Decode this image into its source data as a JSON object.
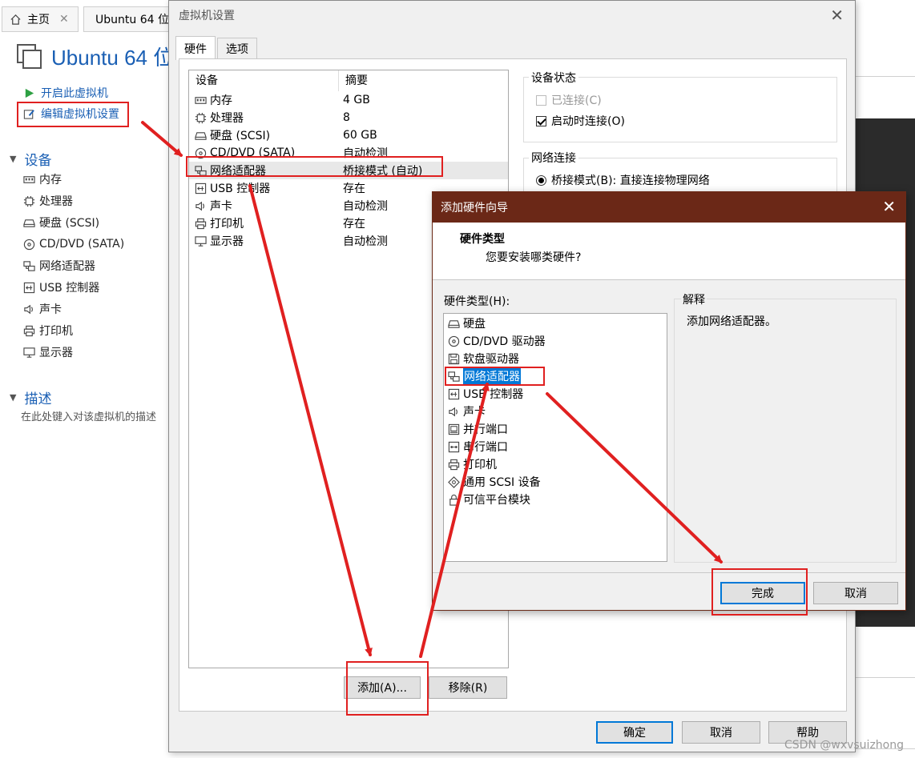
{
  "main_window": {
    "tabs": [
      {
        "label": "主页",
        "icon": "home-icon"
      },
      {
        "label": "Ubuntu 64 位",
        "icon": "vm-icon"
      }
    ],
    "vm_title": "Ubuntu 64 位",
    "actions": [
      {
        "label": "开启此虚拟机",
        "icon": "play-icon"
      },
      {
        "label": "编辑虚拟机设置",
        "icon": "edit-settings-icon"
      }
    ],
    "devices_section": "设备",
    "devices": [
      {
        "label": "内存",
        "icon": "memory-icon"
      },
      {
        "label": "处理器",
        "icon": "cpu-icon"
      },
      {
        "label": "硬盘 (SCSI)",
        "icon": "harddisk-icon"
      },
      {
        "label": "CD/DVD (SATA)",
        "icon": "cdrom-icon"
      },
      {
        "label": "网络适配器",
        "icon": "network-adapter-icon"
      },
      {
        "label": "USB 控制器",
        "icon": "usb-icon"
      },
      {
        "label": "声卡",
        "icon": "sound-icon"
      },
      {
        "label": "打印机",
        "icon": "printer-icon"
      },
      {
        "label": "显示器",
        "icon": "display-icon"
      }
    ],
    "description_section": "描述",
    "description_hint": "在此处键入对该虚拟机的描述"
  },
  "settings_dialog": {
    "title": "虚拟机设置",
    "tabs": [
      "硬件",
      "选项"
    ],
    "device_table": {
      "headers": [
        "设备",
        "摘要"
      ],
      "rows": [
        {
          "device": "内存",
          "summary": "4 GB",
          "icon": "memory-icon"
        },
        {
          "device": "处理器",
          "summary": "8",
          "icon": "cpu-icon"
        },
        {
          "device": "硬盘 (SCSI)",
          "summary": "60 GB",
          "icon": "harddisk-icon"
        },
        {
          "device": "CD/DVD (SATA)",
          "summary": "自动检测",
          "icon": "cdrom-icon"
        },
        {
          "device": "网络适配器",
          "summary": "桥接模式 (自动)",
          "icon": "network-adapter-icon"
        },
        {
          "device": "USB 控制器",
          "summary": "存在",
          "icon": "usb-icon"
        },
        {
          "device": "声卡",
          "summary": "自动检测",
          "icon": "sound-icon"
        },
        {
          "device": "打印机",
          "summary": "存在",
          "icon": "printer-icon"
        },
        {
          "device": "显示器",
          "summary": "自动检测",
          "icon": "display-icon"
        }
      ]
    },
    "device_status": {
      "label": "设备状态",
      "connected": "已连接(C)",
      "connect_on_start": "启动时连接(O)"
    },
    "network": {
      "label": "网络连接",
      "bridged": "桥接模式(B): 直接连接物理网络"
    },
    "buttons": {
      "add": "添加(A)...",
      "remove": "移除(R)",
      "ok": "确定",
      "cancel": "取消",
      "help": "帮助"
    }
  },
  "wizard": {
    "title": "添加硬件向导",
    "heading": "硬件类型",
    "subheading": "您要安装哪类硬件?",
    "list_label": "硬件类型(H):",
    "items": [
      {
        "label": "硬盘",
        "icon": "harddisk-icon"
      },
      {
        "label": "CD/DVD 驱动器",
        "icon": "cdrom-icon"
      },
      {
        "label": "软盘驱动器",
        "icon": "floppy-icon"
      },
      {
        "label": "网络适配器",
        "icon": "network-adapter-icon"
      },
      {
        "label": "USB 控制器",
        "icon": "usb-icon"
      },
      {
        "label": "声卡",
        "icon": "sound-icon"
      },
      {
        "label": "并行端口",
        "icon": "parallel-port-icon"
      },
      {
        "label": "串行端口",
        "icon": "serial-port-icon"
      },
      {
        "label": "打印机",
        "icon": "printer-icon"
      },
      {
        "label": "通用 SCSI 设备",
        "icon": "scsi-icon"
      },
      {
        "label": "可信平台模块",
        "icon": "tpm-icon"
      }
    ],
    "explain_label": "解释",
    "explain_text": "添加网络适配器。",
    "buttons": {
      "finish": "完成",
      "cancel": "取消"
    }
  },
  "watermark": "CSDN @wxvsuizhong",
  "colors": {
    "accent_blue": "#1a5fb4",
    "wizard_titlebar": "#6b2817",
    "selection": "#0078d7",
    "annotation_red": "#e02020"
  }
}
